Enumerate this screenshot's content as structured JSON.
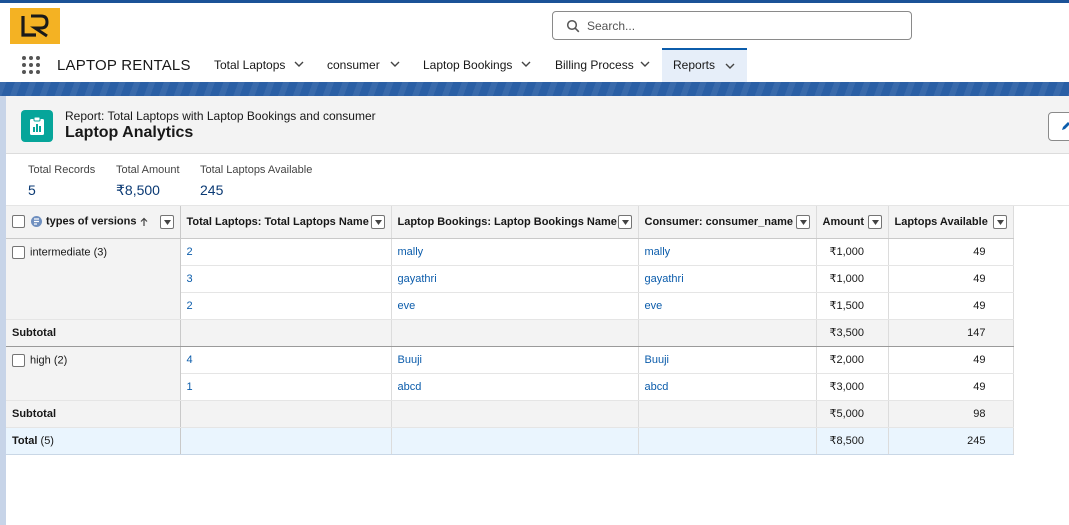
{
  "app": {
    "logo_text": "LR",
    "name": "LAPTOP RENTALS"
  },
  "search": {
    "placeholder": "Search..."
  },
  "nav": {
    "tabs": [
      {
        "label": "Total Laptops"
      },
      {
        "label": "consumer"
      },
      {
        "label": "Laptop Bookings"
      },
      {
        "label": "Billing Process"
      },
      {
        "label": "Reports",
        "active": true
      }
    ]
  },
  "report": {
    "subtitle": "Report: Total Laptops with Laptop Bookings and consumer",
    "title": "Laptop Analytics"
  },
  "summary": [
    {
      "label": "Total Records",
      "value": "5"
    },
    {
      "label": "Total Amount",
      "value": "₹8,500"
    },
    {
      "label": "Total Laptops Available",
      "value": "245"
    }
  ],
  "table": {
    "columns": [
      "types of versions",
      "Total Laptops: Total Laptops Name",
      "Laptop Bookings: Laptop Bookings Name",
      "Consumer: consumer_name",
      "Amount",
      "Laptops Available"
    ],
    "groups": [
      {
        "name": "intermediate",
        "count": "(3)",
        "rows": [
          [
            "2",
            "mally",
            "mally",
            "₹1,000",
            "49"
          ],
          [
            "3",
            "gayathri",
            "gayathri",
            "₹1,000",
            "49"
          ],
          [
            "2",
            "eve",
            "eve",
            "₹1,500",
            "49"
          ]
        ],
        "subtotal_label": "Subtotal",
        "subtotal_amount": "₹3,500",
        "subtotal_available": "147"
      },
      {
        "name": "high",
        "count": "(2)",
        "rows": [
          [
            "4",
            "Buuji",
            "Buuji",
            "₹2,000",
            "49"
          ],
          [
            "1",
            "abcd",
            "abcd",
            "₹3,000",
            "49"
          ]
        ],
        "subtotal_label": "Subtotal",
        "subtotal_amount": "₹5,000",
        "subtotal_available": "98"
      }
    ],
    "total": {
      "label": "Total",
      "count": "(5)",
      "amount": "₹8,500",
      "available": "245"
    }
  },
  "colors": {
    "brand_blue": "#0b5cab",
    "logo_bg": "#f4b223",
    "report_icon": "#06a59a"
  },
  "icons": [
    "search-icon",
    "app-launcher-icon",
    "chevron-down-icon",
    "report-icon",
    "edit-icon",
    "column-menu-icon",
    "group-icon",
    "sort-ascending-icon"
  ]
}
